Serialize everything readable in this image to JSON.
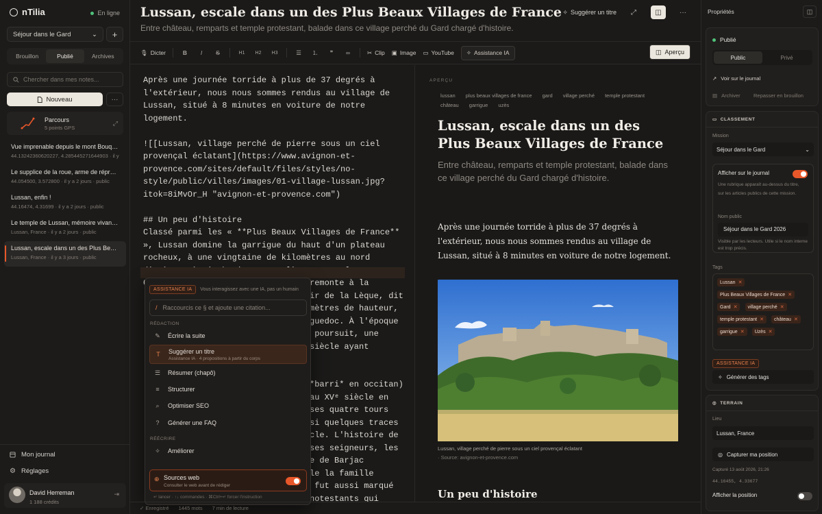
{
  "app": {
    "name": "nTilia",
    "status": "En ligne"
  },
  "sidebar": {
    "journal_select": "Séjour dans le Gard",
    "add_label": "+",
    "tabs": [
      {
        "label": "Brouillon",
        "active": false
      },
      {
        "label": "Publié",
        "active": true
      },
      {
        "label": "Archives",
        "active": false
      }
    ],
    "search_placeholder": "Chercher dans mes notes...",
    "new_label": "Nouveau",
    "more_label": "···",
    "route": {
      "title": "Parcours",
      "meta": "5 points GPS"
    },
    "posts": [
      {
        "title": "Vue imprenable depuis le mont Bouquet",
        "meta": "44.13242360620227, 4.285445271644903 · il y a 2 jours · public",
        "active": false
      },
      {
        "title": "Le supplice de la roue, arme de répressi...",
        "meta": "44.054500, 3.572800 · il y a 2 jours · public",
        "active": false
      },
      {
        "title": "Lussan, enfin !",
        "meta": "44.16474, 4.31699 · il y a 2 jours · public",
        "active": false
      },
      {
        "title": "Le temple de Lussan, mémoire vivante d...",
        "meta": "Lussan, France · il y a 2 jours · public",
        "active": false
      },
      {
        "title": "Lussan, escale dans un des Plus Beaux ...",
        "meta": "Lussan, France · il y a 3 jours · public",
        "active": true
      }
    ],
    "bottom": {
      "journal": "Mon journal",
      "settings": "Réglages"
    },
    "user": {
      "name": "David Herreman",
      "credits": "1 188 crédits"
    }
  },
  "editor": {
    "title": "Lussan, escale dans un des Plus Beaux Villages de France",
    "subtitle": "Entre château, remparts et temple protestant, balade dans ce village perché du Gard chargé d'histoire.",
    "suggest_title": "Suggérer un titre",
    "toolbar": {
      "dictate": "Dicter",
      "bold": "B",
      "italic": "I",
      "strike": "S",
      "h1": "H1",
      "h2": "H2",
      "h3": "H3",
      "clip": "Clip",
      "image": "Image",
      "youtube": "YouTube",
      "assistant": "Assistance IA",
      "preview": "Aperçu"
    },
    "markdown_top": "Après une journée torride à plus de 37 degrés à l'extérieur, nous nous sommes rendus au village de Lussan, situé à 8 minutes en voiture de notre logement.\n\n![[Lussan, village perché de pierre sous un ciel provençal éclatant](https://www.avignon-et-provence.com/sites/default/files/styles/no-style/public/villes/images/01-village-lussan.jpg?itok=8iMvOr_H \"avignon-et-provence.com\")\n\n## Un peu d'histoire\nClassé parmi les « **Plus Beaux Villages de France** », Lussan domine la garrigue du haut d'un plateau rocheux, à une vingtaine de kilomètres au nord d'Uzès et à mi-chemin entre Alès et Bagnols-sur-Cèze.",
    "markdown_right_1": "remonte à la\nir de la Lèque, dit\nmètres de hauteur,\nguedoc. À l'époque\n poursuit, une\nsiècle ayant",
    "markdown_right_2": "*barri* en occitan)\nau XVᵉ siècle en\nses quatre tours\nsi quelques traces\ncle. L'histoire de\nses seigneurs, les\ne de Barjac\nle la famille\n fut aussi marqué\nnotestants qui",
    "status": {
      "saved": "Enregistré",
      "words": "1445 mots",
      "reading": "7 min de lecture"
    }
  },
  "ai_menu": {
    "badge": "ASSISTANCE IA",
    "notice": "Vous interagissez avec une IA, pas un humain",
    "input_placeholder": "Raccourcis ce § et ajoute une citation...",
    "section_write": "RÉDACTION",
    "items_write": [
      {
        "label": "Écrire la suite",
        "icon": "pen-icon"
      },
      {
        "label": "Suggérer un titre",
        "sub": "Assistance IA · 4 propositions à partir du corps",
        "icon": "title-icon"
      },
      {
        "label": "Résumer (chapô)",
        "icon": "list-icon"
      },
      {
        "label": "Structurer",
        "icon": "structure-icon"
      },
      {
        "label": "Optimiser SEO",
        "icon": "search-icon"
      },
      {
        "label": "Générer une FAQ",
        "icon": "help-icon"
      }
    ],
    "section_rewrite": "RÉÉCRIRE",
    "items_rewrite": [
      {
        "label": "Améliorer",
        "icon": "sparkle-icon"
      }
    ],
    "sources": {
      "label": "Sources web",
      "sub": "Consulter le web avant de rédiger",
      "enabled": true
    },
    "footer": "↵ lancer · ↑↓ commandes · ⌘Ctrl+↵ forcer l'instruction"
  },
  "preview": {
    "label": "APERÇU",
    "tags": [
      "lussan",
      "plus beaux villages de france",
      "gard",
      "village perché",
      "temple protestant",
      "château",
      "garrigue",
      "uzès"
    ],
    "title": "Lussan, escale dans un des Plus Beaux Villages de France",
    "subtitle": "Entre château, remparts et temple protestant, balade dans ce village perché du Gard chargé d'histoire.",
    "body": "Après une journée torride à plus de 37 degrés à l'extérieur, nous nous sommes rendus au village de Lussan, situé à 8 minutes en voiture de notre logement.",
    "caption": "Lussan, village perché de pierre sous un ciel provençal éclatant",
    "source": "· Source: avignon-et-provence.com",
    "h2": "Un peu d'histoire"
  },
  "properties": {
    "title": "Propriétés",
    "status": "Publié",
    "visibility": [
      {
        "label": "Public",
        "active": true
      },
      {
        "label": "Privé",
        "active": false
      }
    ],
    "view_link": "Voir sur le journal",
    "archive": "Archiver",
    "back_draft": "Repasser en brouillon",
    "classification": {
      "header": "CLASSEMENT",
      "mission_label": "Mission",
      "mission_value": "Séjour dans le Gard",
      "show_on_journal": "Afficher sur le journal",
      "show_on_journal_on": true,
      "show_desc": "Une rubrique apparaît au-dessus du titre, sur les articles publics de cette mission.",
      "public_name_label": "Nom public",
      "public_name_value": "Séjour dans le Gard 2026",
      "public_name_desc": "Visible par les lecteurs. Utile si le nom interne est trop précis.",
      "tags_label": "Tags",
      "tags": [
        "Lussan",
        "Plus Beaux Villages de France",
        "Gard",
        "village perché",
        "temple protestant",
        "château",
        "garrigue",
        "Uzès"
      ],
      "ai_badge": "ASSISTANCE IA",
      "generate_tags": "Générer des tags"
    },
    "terrain": {
      "header": "TERRAIN",
      "place_label": "Lieu",
      "place_value": "Lussan, France",
      "capture": "Capturer ma position",
      "captured": "Capturé 13 août 2026, 21:26",
      "coords": "44.16455, 4.33677",
      "show_position": "Afficher la position",
      "show_position_on": false
    }
  },
  "colors": {
    "accent": "#e8572a",
    "online": "#4fc27a",
    "background": "#1a1918"
  }
}
